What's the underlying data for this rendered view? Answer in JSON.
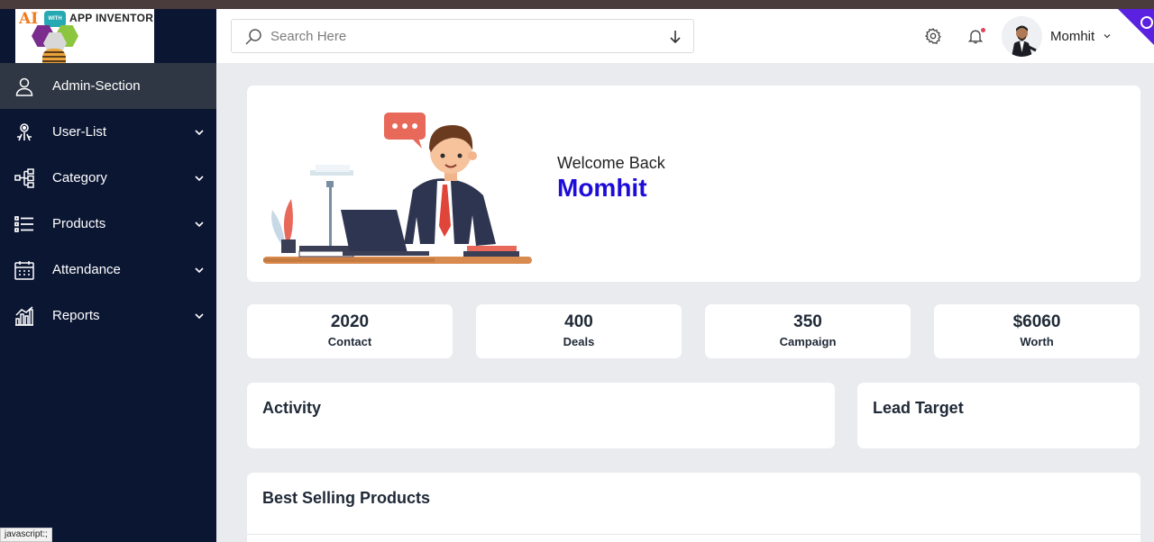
{
  "logo": {
    "ai": "AI",
    "with": "WITH",
    "text": "APP INVENTOR"
  },
  "sidebar": {
    "items": [
      {
        "label": "Admin-Section",
        "icon": "user-icon"
      },
      {
        "label": "User-List",
        "icon": "users-icon"
      },
      {
        "label": "Category",
        "icon": "tree-icon"
      },
      {
        "label": "Products",
        "icon": "list-icon"
      },
      {
        "label": "Attendance",
        "icon": "calendar-icon"
      },
      {
        "label": "Reports",
        "icon": "bar-chart-icon"
      }
    ]
  },
  "status_tip": "javascript:;",
  "header": {
    "search_placeholder": "Search Here",
    "username": "Momhit"
  },
  "welcome": {
    "greeting": "Welcome Back",
    "name": "Momhit"
  },
  "stats": [
    {
      "value": "2020",
      "label": "Contact"
    },
    {
      "value": "400",
      "label": "Deals"
    },
    {
      "value": "350",
      "label": "Campaign"
    },
    {
      "value": "$6060",
      "label": "Worth"
    }
  ],
  "panels": {
    "activity": "Activity",
    "lead_target": "Lead Target",
    "best_selling": "Best Selling Products"
  },
  "colors": {
    "sidebar_bg": "#0b1633",
    "active_item": "#2f3744",
    "accent_name": "#1e0cd9",
    "corner_badge": "#5b21e0"
  }
}
